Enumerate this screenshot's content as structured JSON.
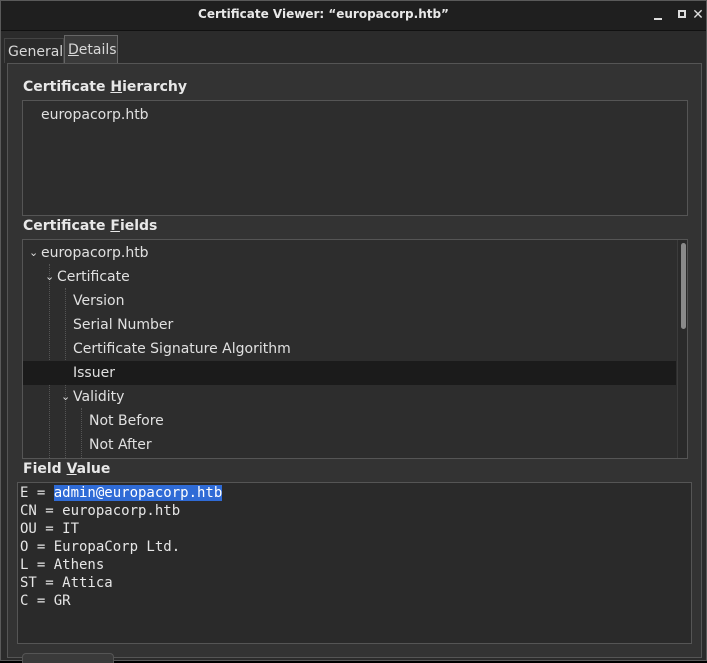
{
  "window": {
    "title": "Certificate Viewer: “europacorp.htb”"
  },
  "tabs": {
    "general_pre": "General",
    "general_u": "",
    "details_pre": "",
    "details_u": "D",
    "details_post": "etails"
  },
  "hierarchy": {
    "label_pre": "Certificate ",
    "label_u": "H",
    "label_post": "ierarchy",
    "items": [
      "europacorp.htb"
    ]
  },
  "fields": {
    "label_pre": "Certificate ",
    "label_u": "F",
    "label_post": "ields",
    "rows": [
      {
        "text": "europacorp.htb",
        "expanded": true
      },
      {
        "text": "Certificate",
        "expanded": true
      },
      {
        "text": "Version"
      },
      {
        "text": "Serial Number"
      },
      {
        "text": "Certificate Signature Algorithm"
      },
      {
        "text": "Issuer",
        "selected": true
      },
      {
        "text": "Validity",
        "expanded": true
      },
      {
        "text": "Not Before"
      },
      {
        "text": "Not After"
      }
    ]
  },
  "field_value": {
    "label_pre": "Field ",
    "label_u": "V",
    "label_post": "alue",
    "first_prefix": "E = ",
    "first_highlight": "admin@europacorp.htb",
    "lines": [
      "CN = europacorp.htb",
      "OU = IT",
      "O = EuropaCorp Ltd.",
      "L = Athens",
      "ST = Attica",
      "C = GR"
    ]
  },
  "colors": {
    "selection_highlight": "#2f6bd6",
    "selected_row": "#1b1b1b",
    "background": "#333333"
  }
}
